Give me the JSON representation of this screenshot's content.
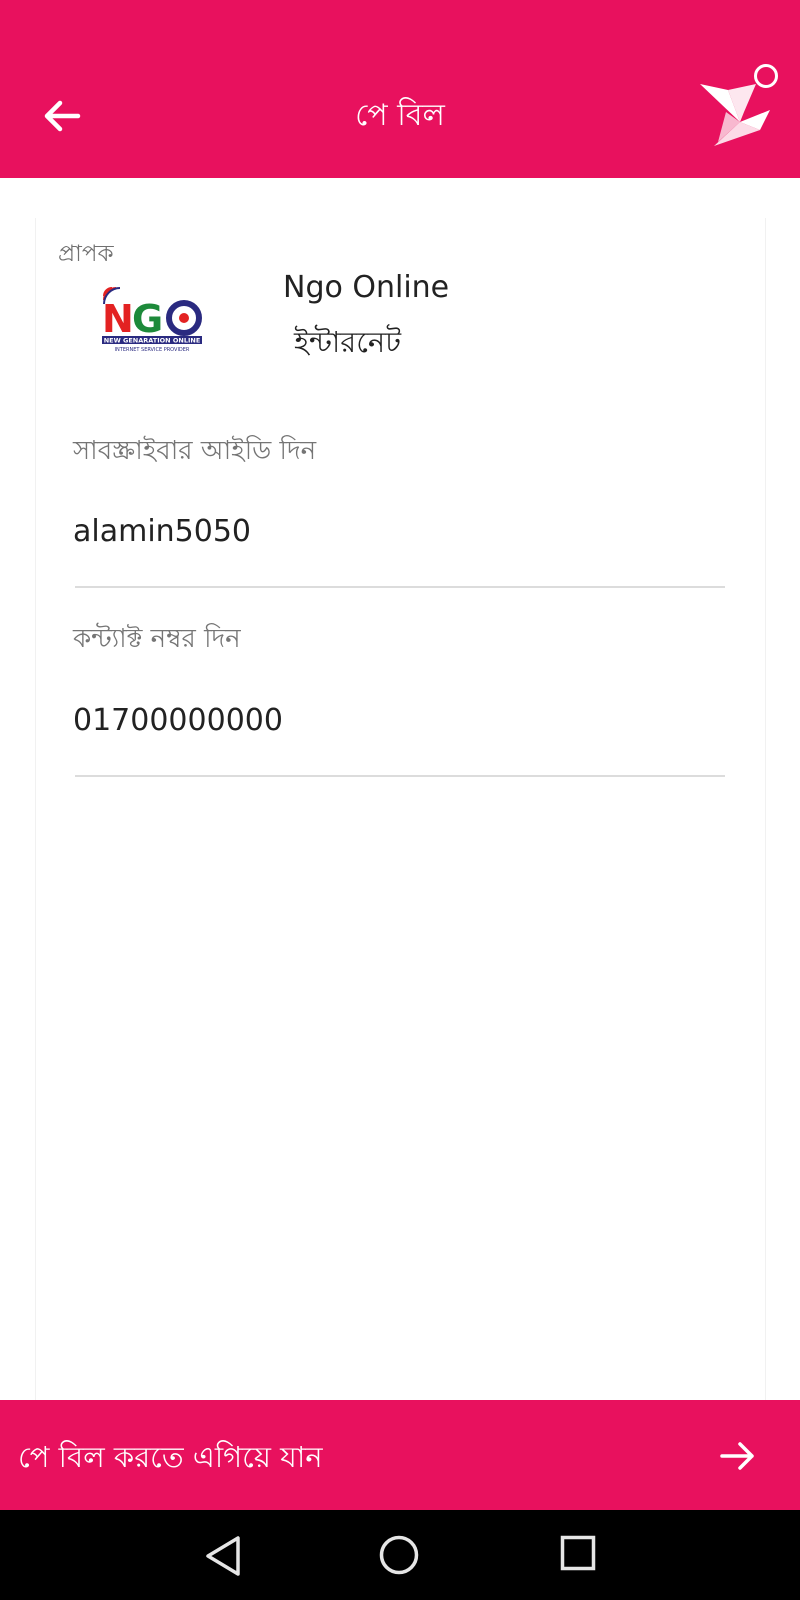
{
  "header": {
    "title": "পে বিল",
    "back_icon": "arrow-left-icon",
    "brand_icon": "origami-bird-icon"
  },
  "recipient": {
    "label": "প্রাপক",
    "logo_icon": "ngo-logo",
    "logo_text": "NGO",
    "logo_subtitle": "NEW GENARATION ONLINE",
    "logo_tagline": "INTERNET SERVICE PROVIDER",
    "name": "Ngo Online",
    "type": "ইন্টারনেট"
  },
  "fields": {
    "subscriber_id": {
      "label": "সাবস্ক্রাইবার আইডি দিন",
      "value": "alamin5050"
    },
    "contact_number": {
      "label": "কন্ট্যাক্ট নম্বর দিন",
      "value": "01700000000"
    }
  },
  "proceed": {
    "label": "পে বিল করতে এগিয়ে যান",
    "icon": "arrow-right-icon"
  },
  "system_nav": {
    "back_icon": "nav-back-icon",
    "home_icon": "nav-home-icon",
    "recents_icon": "nav-recents-icon"
  },
  "colors": {
    "brand": "#e8115e",
    "text_primary": "#222222",
    "text_secondary": "#757575"
  }
}
